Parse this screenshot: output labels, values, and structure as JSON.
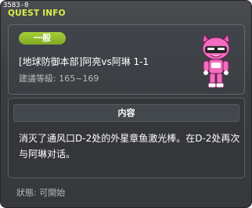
{
  "debug_id": "3583-0",
  "window": {
    "title": "QUEST INFO"
  },
  "quest": {
    "category_badge": "一般",
    "name": "[地球防御本部]阿亮vs阿琳 1-1",
    "level_requirement": "建議等級: 165~169",
    "npc_icon": "pink-masked-hero-npc-icon"
  },
  "content": {
    "header": "内容",
    "text": "消灭了通风口D-2处的外星章鱼激光棒。在D-2处再次与阿琳对话。"
  },
  "status": {
    "text": "狀態: 可開始"
  },
  "colors": {
    "title": "#d8f24a",
    "badge": "#94c030",
    "background": "#3a3c40"
  }
}
